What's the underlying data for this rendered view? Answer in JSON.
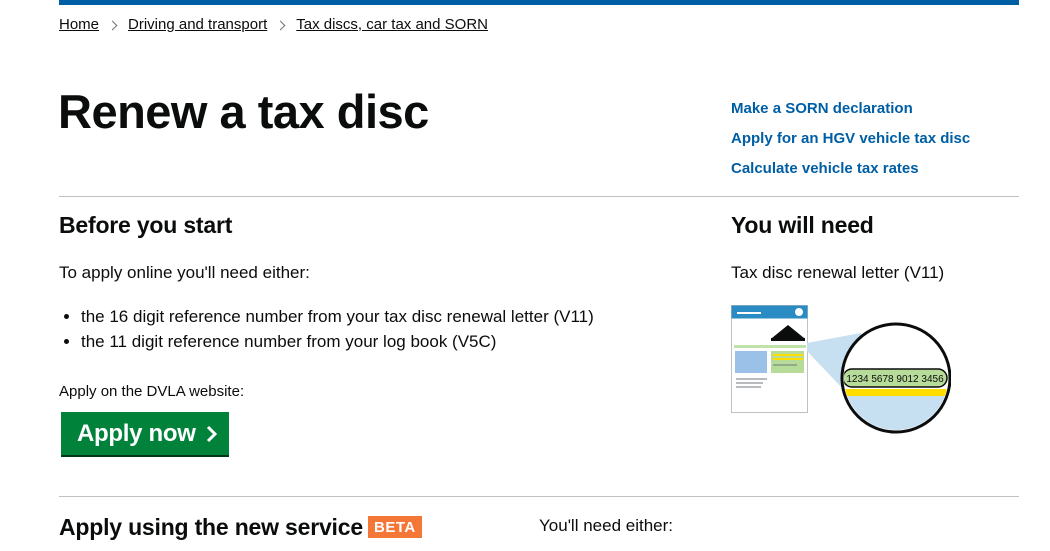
{
  "breadcrumb": {
    "items": [
      "Home",
      "Driving and transport",
      "Tax discs, car tax and SORN"
    ]
  },
  "page": {
    "title": "Renew a tax disc"
  },
  "related_links": [
    "Make a SORN declaration",
    "Apply for an HGV vehicle tax disc",
    "Calculate vehicle tax rates"
  ],
  "before_start": {
    "heading": "Before you start",
    "intro": "To apply online you'll need either:",
    "bullets": [
      "the 16 digit reference number from your tax disc renewal letter (V11)",
      "the 11 digit reference number from your log book (V5C)"
    ],
    "apply_note": "Apply on the DVLA website:",
    "apply_button": "Apply now"
  },
  "you_will_need": {
    "heading": "You will need",
    "item": "Tax disc renewal letter (V11)",
    "illustration_number": "1234 5678 9012 3456"
  },
  "new_service": {
    "heading": "Apply using the new service",
    "badge": "BETA",
    "need_text": "You'll need either:"
  },
  "colors": {
    "link": "#005ea5",
    "button": "#00823b",
    "badge": "#f47738",
    "topbar": "#005ea5"
  }
}
